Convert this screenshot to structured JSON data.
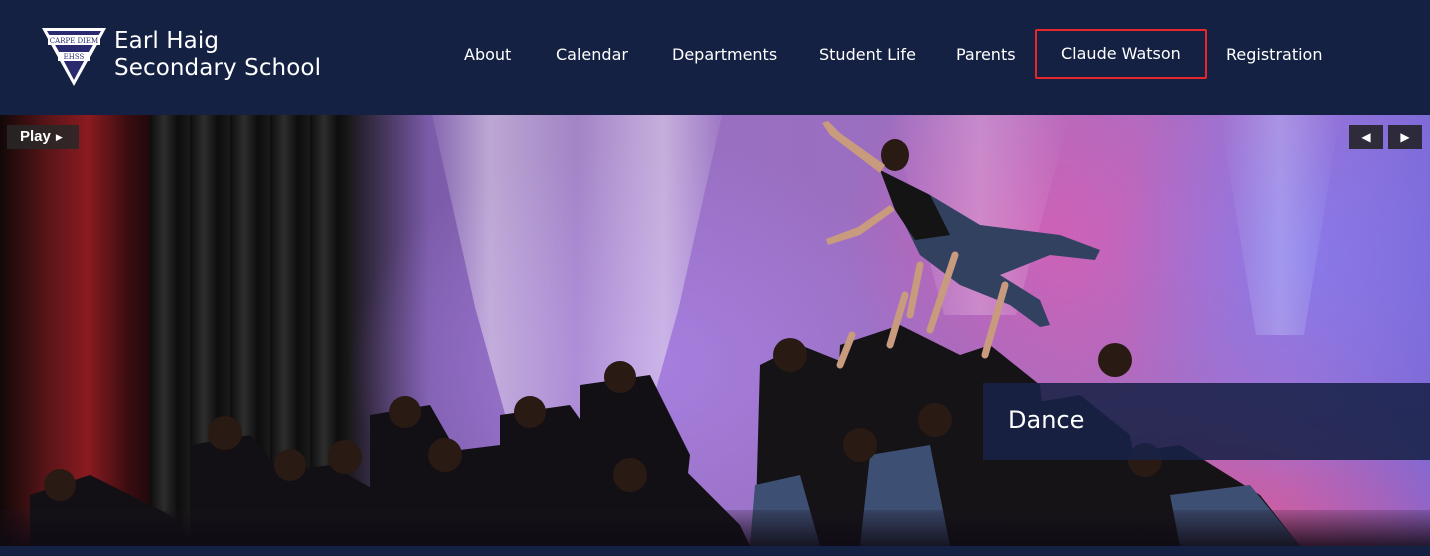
{
  "header": {
    "school_name_line1": "Earl Haig",
    "school_name_line2": "Secondary School",
    "crest_text_top": "CARPE DIEM",
    "crest_text_bottom": "EHSS"
  },
  "nav": {
    "items": [
      {
        "label": "About"
      },
      {
        "label": "Calendar"
      },
      {
        "label": "Departments"
      },
      {
        "label": "Student Life"
      },
      {
        "label": "Parents"
      },
      {
        "label": "Claude Watson",
        "highlighted": true
      },
      {
        "label": "Registration"
      }
    ]
  },
  "slideshow": {
    "play_label": "Play",
    "caption": "Dance",
    "prev_icon": "chevron-left-icon",
    "next_icon": "chevron-right-icon"
  },
  "colors": {
    "header_bg": "#152143",
    "highlight_border": "#e8272b",
    "caption_bg": "#182248"
  }
}
